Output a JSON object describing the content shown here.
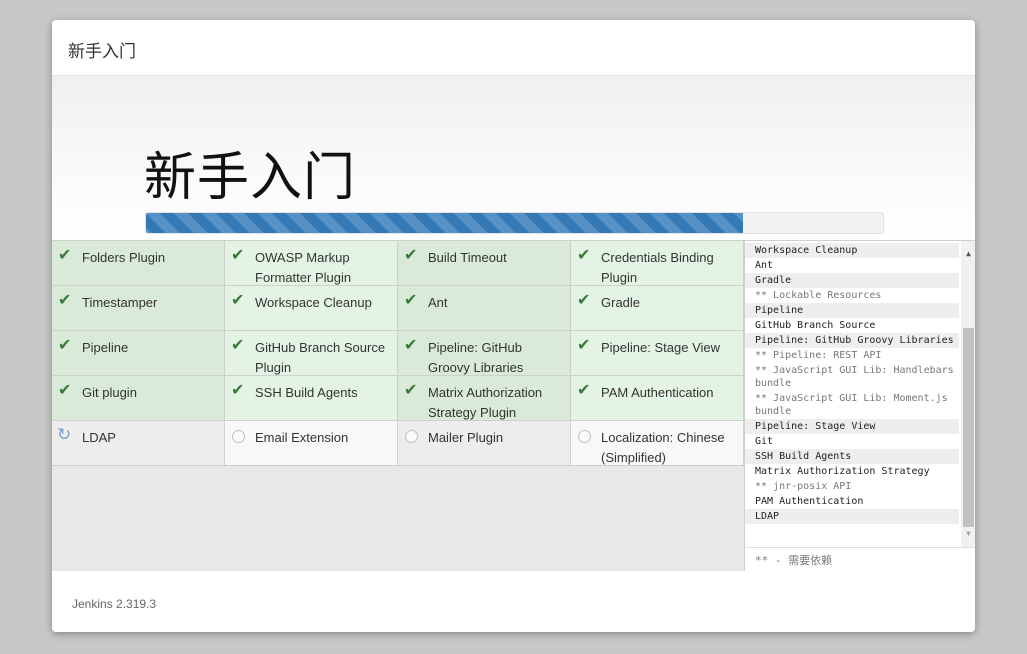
{
  "header": {
    "title": "新手入门"
  },
  "hero": {
    "title": "新手入门",
    "progress_percent": 81
  },
  "plugins": [
    {
      "label": "Folders Plugin",
      "status": "success"
    },
    {
      "label": "OWASP Markup Formatter Plugin",
      "status": "success"
    },
    {
      "label": "Build Timeout",
      "status": "success"
    },
    {
      "label": "Credentials Binding Plugin",
      "status": "success"
    },
    {
      "label": "Timestamper",
      "status": "success"
    },
    {
      "label": "Workspace Cleanup",
      "status": "success"
    },
    {
      "label": "Ant",
      "status": "success"
    },
    {
      "label": "Gradle",
      "status": "success"
    },
    {
      "label": "Pipeline",
      "status": "success"
    },
    {
      "label": "GitHub Branch Source Plugin",
      "status": "success"
    },
    {
      "label": "Pipeline: GitHub Groovy Libraries",
      "status": "success"
    },
    {
      "label": "Pipeline: Stage View",
      "status": "success"
    },
    {
      "label": "Git plugin",
      "status": "success"
    },
    {
      "label": "SSH Build Agents",
      "status": "success"
    },
    {
      "label": "Matrix Authorization Strategy Plugin",
      "status": "success"
    },
    {
      "label": "PAM Authentication",
      "status": "success"
    },
    {
      "label": "LDAP",
      "status": "installing"
    },
    {
      "label": "Email Extension",
      "status": "pending"
    },
    {
      "label": "Mailer Plugin",
      "status": "pending"
    },
    {
      "label": "Localization: Chinese (Simplified)",
      "status": "pending"
    }
  ],
  "log": {
    "lines": [
      {
        "text": "Workspace Cleanup",
        "dep": false,
        "shade": true
      },
      {
        "text": "Ant",
        "dep": false,
        "shade": false
      },
      {
        "text": "Gradle",
        "dep": false,
        "shade": true
      },
      {
        "text": "** Lockable Resources",
        "dep": true,
        "shade": false
      },
      {
        "text": "Pipeline",
        "dep": false,
        "shade": true
      },
      {
        "text": "GitHub Branch Source",
        "dep": false,
        "shade": false
      },
      {
        "text": "Pipeline: GitHub Groovy Libraries",
        "dep": false,
        "shade": true
      },
      {
        "text": "** Pipeline: REST API",
        "dep": true,
        "shade": false
      },
      {
        "text": "** JavaScript GUI Lib: Handlebars bundle",
        "dep": true,
        "shade": false
      },
      {
        "text": "** JavaScript GUI Lib: Moment.js bundle",
        "dep": true,
        "shade": false
      },
      {
        "text": "Pipeline: Stage View",
        "dep": false,
        "shade": true
      },
      {
        "text": "Git",
        "dep": false,
        "shade": false
      },
      {
        "text": "SSH Build Agents",
        "dep": false,
        "shade": true
      },
      {
        "text": "Matrix Authorization Strategy",
        "dep": false,
        "shade": false
      },
      {
        "text": "** jnr-posix API",
        "dep": true,
        "shade": false
      },
      {
        "text": "PAM Authentication",
        "dep": false,
        "shade": false
      },
      {
        "text": "LDAP",
        "dep": false,
        "shade": true
      }
    ],
    "legend": "** - 需要依赖"
  },
  "footer": {
    "version": "Jenkins 2.319.3"
  }
}
